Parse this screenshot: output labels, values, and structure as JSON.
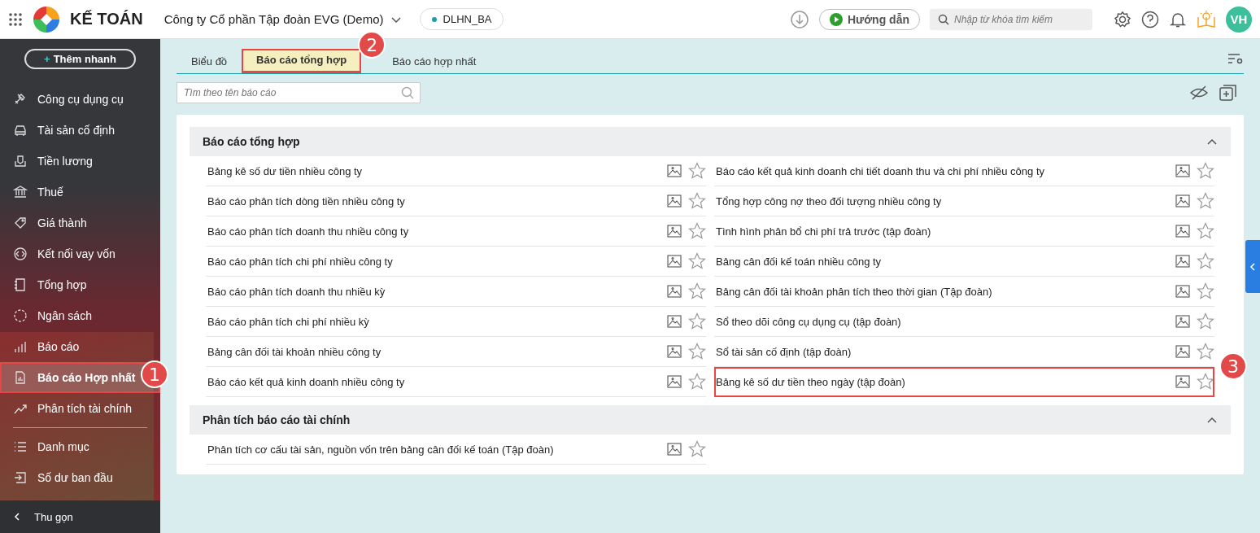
{
  "topbar": {
    "app_name": "KẾ TOÁN",
    "company": "Công ty Cổ phần Tập đoàn EVG (Demo)",
    "database": "DLHN_BA",
    "guide_button": "Hướng dẫn",
    "search": {
      "placeholder": "Nhập từ khóa tìm kiếm"
    },
    "avatar": "VH"
  },
  "sidebar": {
    "quick_add_plus": "+",
    "quick_add": "Thêm nhanh",
    "items": [
      {
        "label": "Công cụ dụng cụ",
        "selected": false
      },
      {
        "label": "Tài sản cố định",
        "selected": false
      },
      {
        "label": "Tiền lương",
        "selected": false
      },
      {
        "label": "Thuế",
        "selected": false
      },
      {
        "label": "Giá thành",
        "selected": false
      },
      {
        "label": "Kết nối vay vốn",
        "selected": false
      },
      {
        "label": "Tổng hợp",
        "selected": false
      },
      {
        "label": "Ngân sách",
        "selected": false
      },
      {
        "label": "Báo cáo",
        "selected": false
      },
      {
        "label": "Báo cáo Hợp nhất",
        "selected": true,
        "callout": "1"
      },
      {
        "label": "Phân tích tài chính",
        "selected": false
      },
      {
        "label": "Danh mục",
        "selected": false,
        "divider_before": true
      },
      {
        "label": "Số dư ban đầu",
        "selected": false
      }
    ],
    "collapse": "Thu gọn"
  },
  "tabs": [
    {
      "label": "Biểu đồ",
      "selected": false
    },
    {
      "label": "Báo cáo tổng hợp",
      "selected": true,
      "callout": "2"
    },
    {
      "label": "Báo cáo hợp nhất",
      "selected": false
    }
  ],
  "report_search": {
    "placeholder": "Tìm theo tên báo cáo"
  },
  "sections": [
    {
      "title": "Báo cáo tổng hợp",
      "expanded": true,
      "columns": [
        {
          "reports": [
            {
              "name": "Bảng kê số dư tiền nhiều công ty"
            },
            {
              "name": "Báo cáo phân tích dòng tiền nhiều công ty"
            },
            {
              "name": "Báo cáo phân tích doanh thu nhiều công ty"
            },
            {
              "name": "Báo cáo phân tích chi phí nhiều công ty"
            },
            {
              "name": "Báo cáo phân tích doanh thu nhiều kỳ"
            },
            {
              "name": "Báo cáo phân tích chi phí nhiều kỳ"
            },
            {
              "name": "Bảng cân đối tài khoản nhiều công ty"
            },
            {
              "name": "Báo cáo kết quả kinh doanh nhiều công ty"
            }
          ]
        },
        {
          "reports": [
            {
              "name": "Báo cáo kết quả kinh doanh chi tiết doanh thu và chi phí nhiều công ty"
            },
            {
              "name": "Tổng hợp công nợ theo đối tượng nhiều công ty"
            },
            {
              "name": "Tình hình phân bổ chi phí trả trước (tập đoàn)"
            },
            {
              "name": "Bảng cân đối kế toán nhiều công ty"
            },
            {
              "name": "Bảng cân đối tài khoản phân tích theo thời gian (Tập đoàn)"
            },
            {
              "name": "Sổ theo dõi công cụ dụng cụ (tập đoàn)"
            },
            {
              "name": "Sổ tài sản cố định (tập đoàn)"
            },
            {
              "name": "Bảng kê số dư tiền theo ngày (tập đoàn)",
              "callout": "3"
            }
          ]
        }
      ]
    },
    {
      "title": "Phân tích báo cáo tài chính",
      "expanded": true,
      "columns": [
        {
          "reports": [
            {
              "name": "Phân tích cơ cấu tài sản, nguồn vốn trên bảng cân đối kế toán (Tập đoàn)"
            }
          ]
        }
      ]
    }
  ]
}
